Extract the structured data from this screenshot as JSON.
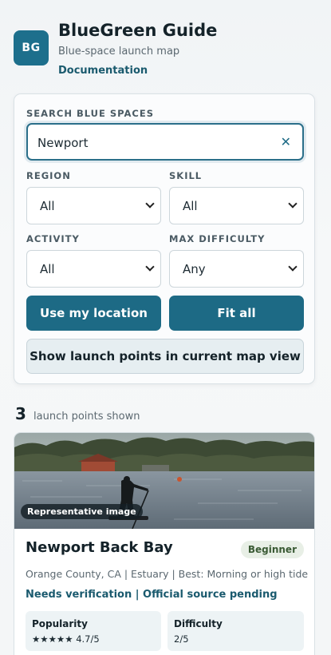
{
  "header": {
    "logo_text": "BG",
    "title": "BlueGreen Guide",
    "subtitle": "Blue-space launch map",
    "doc_link": "Documentation"
  },
  "filters": {
    "search_label": "SEARCH BLUE SPACES",
    "search_value": "Newport",
    "clear_glyph": "✕",
    "region_label": "REGION",
    "region_value": "All",
    "skill_label": "SKILL",
    "skill_value": "All",
    "activity_label": "ACTIVITY",
    "activity_value": "All",
    "difficulty_label": "MAX DIFFICULTY",
    "difficulty_value": "Any",
    "use_location": "Use my location",
    "fit_all": "Fit all",
    "show_in_view": "Show launch points in current map view"
  },
  "results": {
    "count": "3",
    "count_text": "launch points shown"
  },
  "cards": [
    {
      "image_badge": "Representative image",
      "title": "Newport Back Bay",
      "level": "Beginner",
      "meta": "Orange County, CA | Estuary | Best: Morning or high tide",
      "verification": "Needs verification | Official source pending",
      "popularity_label": "Popularity",
      "popularity_value": "★★★★★ 4.7/5",
      "difficulty_label": "Difficulty",
      "difficulty_value": "2/5"
    }
  ],
  "colors": {
    "accent": "#1d6a85",
    "link": "#1a5a6e",
    "badge_bg": "#e8efe6"
  }
}
